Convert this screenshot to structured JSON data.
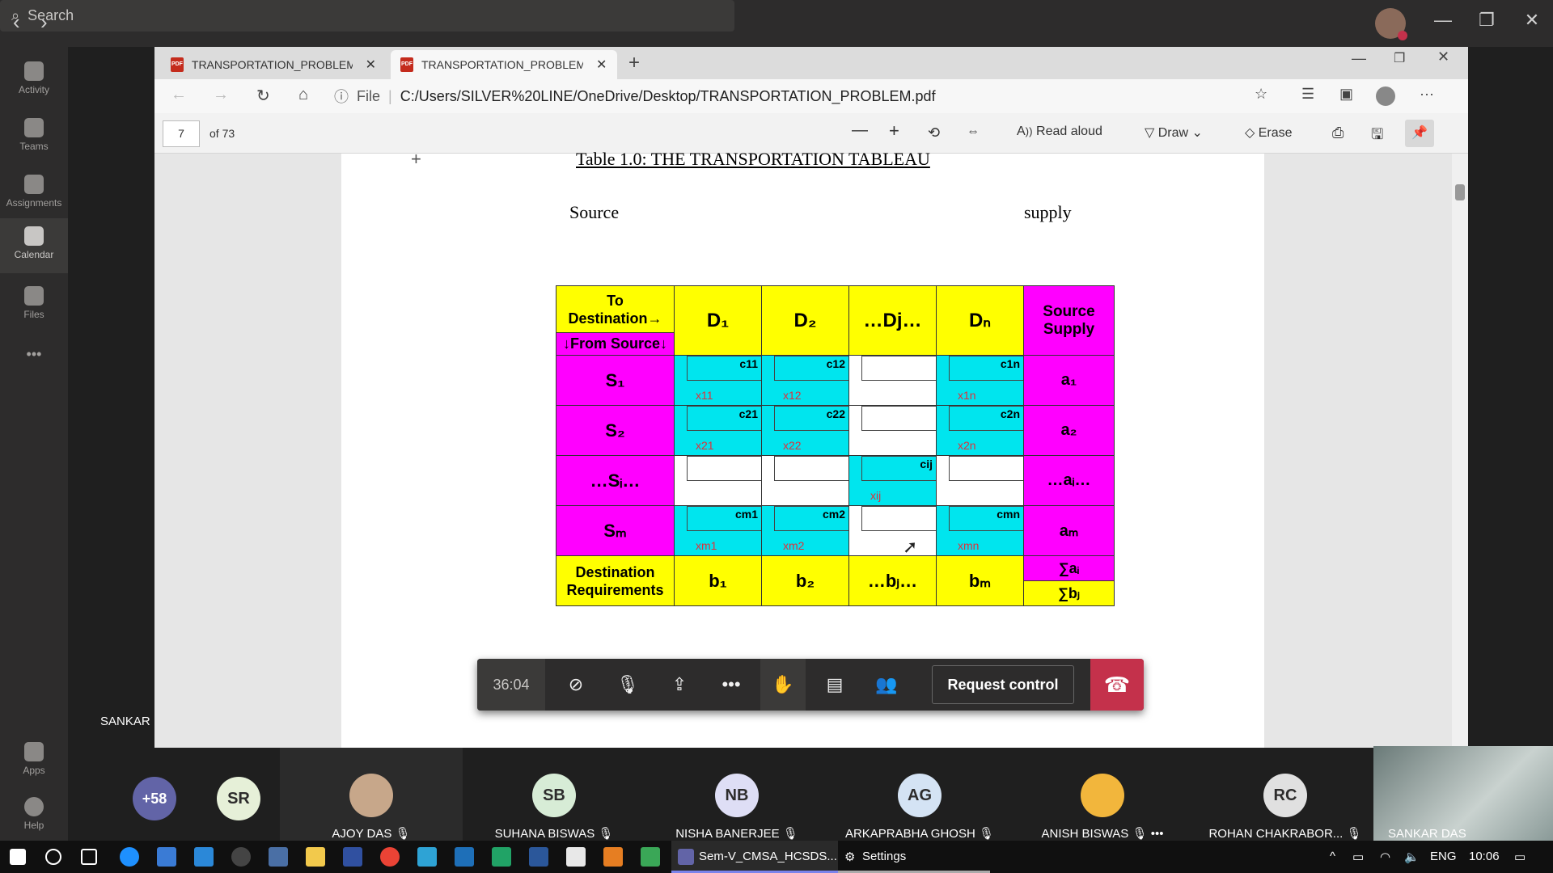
{
  "titlebar": {
    "search_placeholder": "Search"
  },
  "rail": {
    "items": [
      {
        "label": "Activity",
        "icon": "bell-icon"
      },
      {
        "label": "Teams",
        "icon": "teams-icon"
      },
      {
        "label": "Assignments",
        "icon": "backpack-icon"
      },
      {
        "label": "Calendar",
        "icon": "calendar-icon"
      },
      {
        "label": "Files",
        "icon": "files-icon"
      },
      {
        "label": "Apps",
        "icon": "apps-icon"
      },
      {
        "label": "Help",
        "icon": "help-icon"
      }
    ],
    "more": "•••"
  },
  "browser": {
    "tabs": [
      {
        "title": "TRANSPORTATION_PROBLEM.p..."
      },
      {
        "title": "TRANSPORTATION_PROBLEM.p..."
      }
    ],
    "file_label": "File",
    "url": "C:/Users/SILVER%20LINE/OneDrive/Desktop/TRANSPORTATION_PROBLEM.pdf",
    "page_number": "7",
    "page_total": "of 73",
    "read_aloud": "Read aloud",
    "draw": "Draw",
    "erase": "Erase"
  },
  "pdf": {
    "title": "Table 1.0: THE TRANSPORTATION TABLEAU",
    "source_label": "Source",
    "supply_label": "supply",
    "table": {
      "header": {
        "to": "To",
        "destination": "Destination→",
        "from": "↓From Source↓",
        "cols": [
          "D₁",
          "D₂",
          "…Dj…",
          "Dₙ"
        ],
        "supply": "Source Supply"
      },
      "rows": [
        {
          "label": "S₁",
          "cells": [
            {
              "c": "c11",
              "x": "x11"
            },
            {
              "c": "c12",
              "x": "x12"
            },
            {
              "c": "",
              "x": ""
            },
            {
              "c": "c1n",
              "x": "x1n"
            }
          ],
          "supply": "a₁"
        },
        {
          "label": "S₂",
          "cells": [
            {
              "c": "c21",
              "x": "x21"
            },
            {
              "c": "c22",
              "x": "x22"
            },
            {
              "c": "",
              "x": ""
            },
            {
              "c": "c2n",
              "x": "x2n"
            }
          ],
          "supply": "a₂"
        },
        {
          "label": "…Sᵢ…",
          "cells": [
            {
              "c": "",
              "x": ""
            },
            {
              "c": "",
              "x": ""
            },
            {
              "c": "cij",
              "x": "xij"
            },
            {
              "c": "",
              "x": ""
            }
          ],
          "supply": "…aᵢ…"
        },
        {
          "label": "Sₘ",
          "cells": [
            {
              "c": "cm1",
              "x": "xm1"
            },
            {
              "c": "cm2",
              "x": "xm2"
            },
            {
              "c": "",
              "x": ""
            },
            {
              "c": "cmn",
              "x": "xmn"
            }
          ],
          "supply": "aₘ"
        }
      ],
      "footer": {
        "label": "Destination Requirements",
        "values": [
          "b₁",
          "b₂",
          "…bⱼ…",
          "bₘ"
        ],
        "sum_a": "∑aᵢ",
        "sum_b": "∑bⱼ"
      }
    }
  },
  "call": {
    "timer": "36:04",
    "request_control": "Request control",
    "presenter_name": "SANKAR DAS"
  },
  "participants": {
    "overflow": "+58",
    "list": [
      {
        "initials": "SR",
        "name": ""
      },
      {
        "initials": "",
        "name": "AJOY DAS"
      },
      {
        "initials": "SB",
        "name": "SUHANA BISWAS"
      },
      {
        "initials": "NB",
        "name": "NISHA BANERJEE"
      },
      {
        "initials": "AG",
        "name": "ARKAPRABHA GHOSH"
      },
      {
        "initials": "",
        "name": "ANISH BISWAS"
      },
      {
        "initials": "RC",
        "name": "ROHAN CHAKRABOR..."
      },
      {
        "initials": "",
        "name": "SANKAR DAS"
      }
    ]
  },
  "taskbar": {
    "teams_window": "Sem-V_CMSA_HCSDS...",
    "settings": "Settings",
    "language": "ENG",
    "time": "10:06"
  },
  "colors": {
    "yellow": "#ffff00",
    "magenta": "#ff00ff",
    "cyan": "#00e5ee",
    "hangup": "#c4314b",
    "avatar_purple": "#6264a7"
  }
}
